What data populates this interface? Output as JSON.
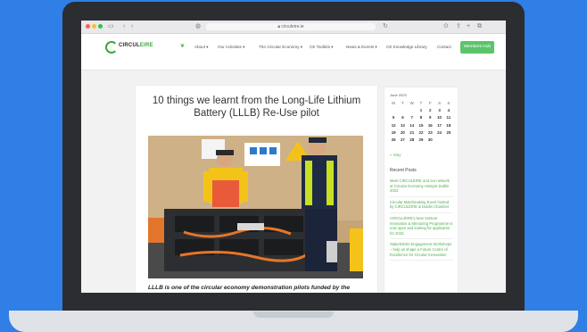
{
  "browser": {
    "url": "circuleire.ie"
  },
  "header": {
    "logo_text_part1": "CIRCUL",
    "logo_text_part2": "EIRE",
    "nav_items": [
      "About",
      "Our Activities",
      "The Circular Economy",
      "CE Toolkits",
      "News & Events",
      "CE Knowledge Library",
      "Contact"
    ],
    "member_button": "Members Hub"
  },
  "post": {
    "title": "10 things we learnt from the Long-Life Lithium Battery (LLLB) Re-Use pilot",
    "lead": "LLLB is one of the circular economy demonstration pilots funded by the"
  },
  "sidebar": {
    "calendar_caption": "June 2023",
    "weekdays": [
      "M",
      "T",
      "W",
      "T",
      "F",
      "S",
      "S"
    ],
    "weeks": [
      [
        "",
        "",
        "",
        "1",
        "2",
        "3",
        "4"
      ],
      [
        "5",
        "6",
        "7",
        "8",
        "9",
        "10",
        "11"
      ],
      [
        "12",
        "13",
        "14",
        "15",
        "16",
        "17",
        "18"
      ],
      [
        "19",
        "20",
        "21",
        "22",
        "23",
        "24",
        "25"
      ],
      [
        "26",
        "27",
        "28",
        "29",
        "30",
        "",
        ""
      ]
    ],
    "prev_link": "« May",
    "recent_heading": "Recent Posts",
    "recent_posts": [
      "Meet CIRCULÉIRE and our network at Circular Economy Hotspot Dublin 2023",
      "Circular Matchmaking Event hosted by CIRCULÉIRE & Dublin Chamber",
      "CIRCULÉIRE’s New Venture Innovation & Mentoring Programme is now open and looking for applicants for 2023.",
      "Stakeholder Engagement Workshops – help us shape a Future Centre of Excellence for Circular Innovation!"
    ]
  }
}
